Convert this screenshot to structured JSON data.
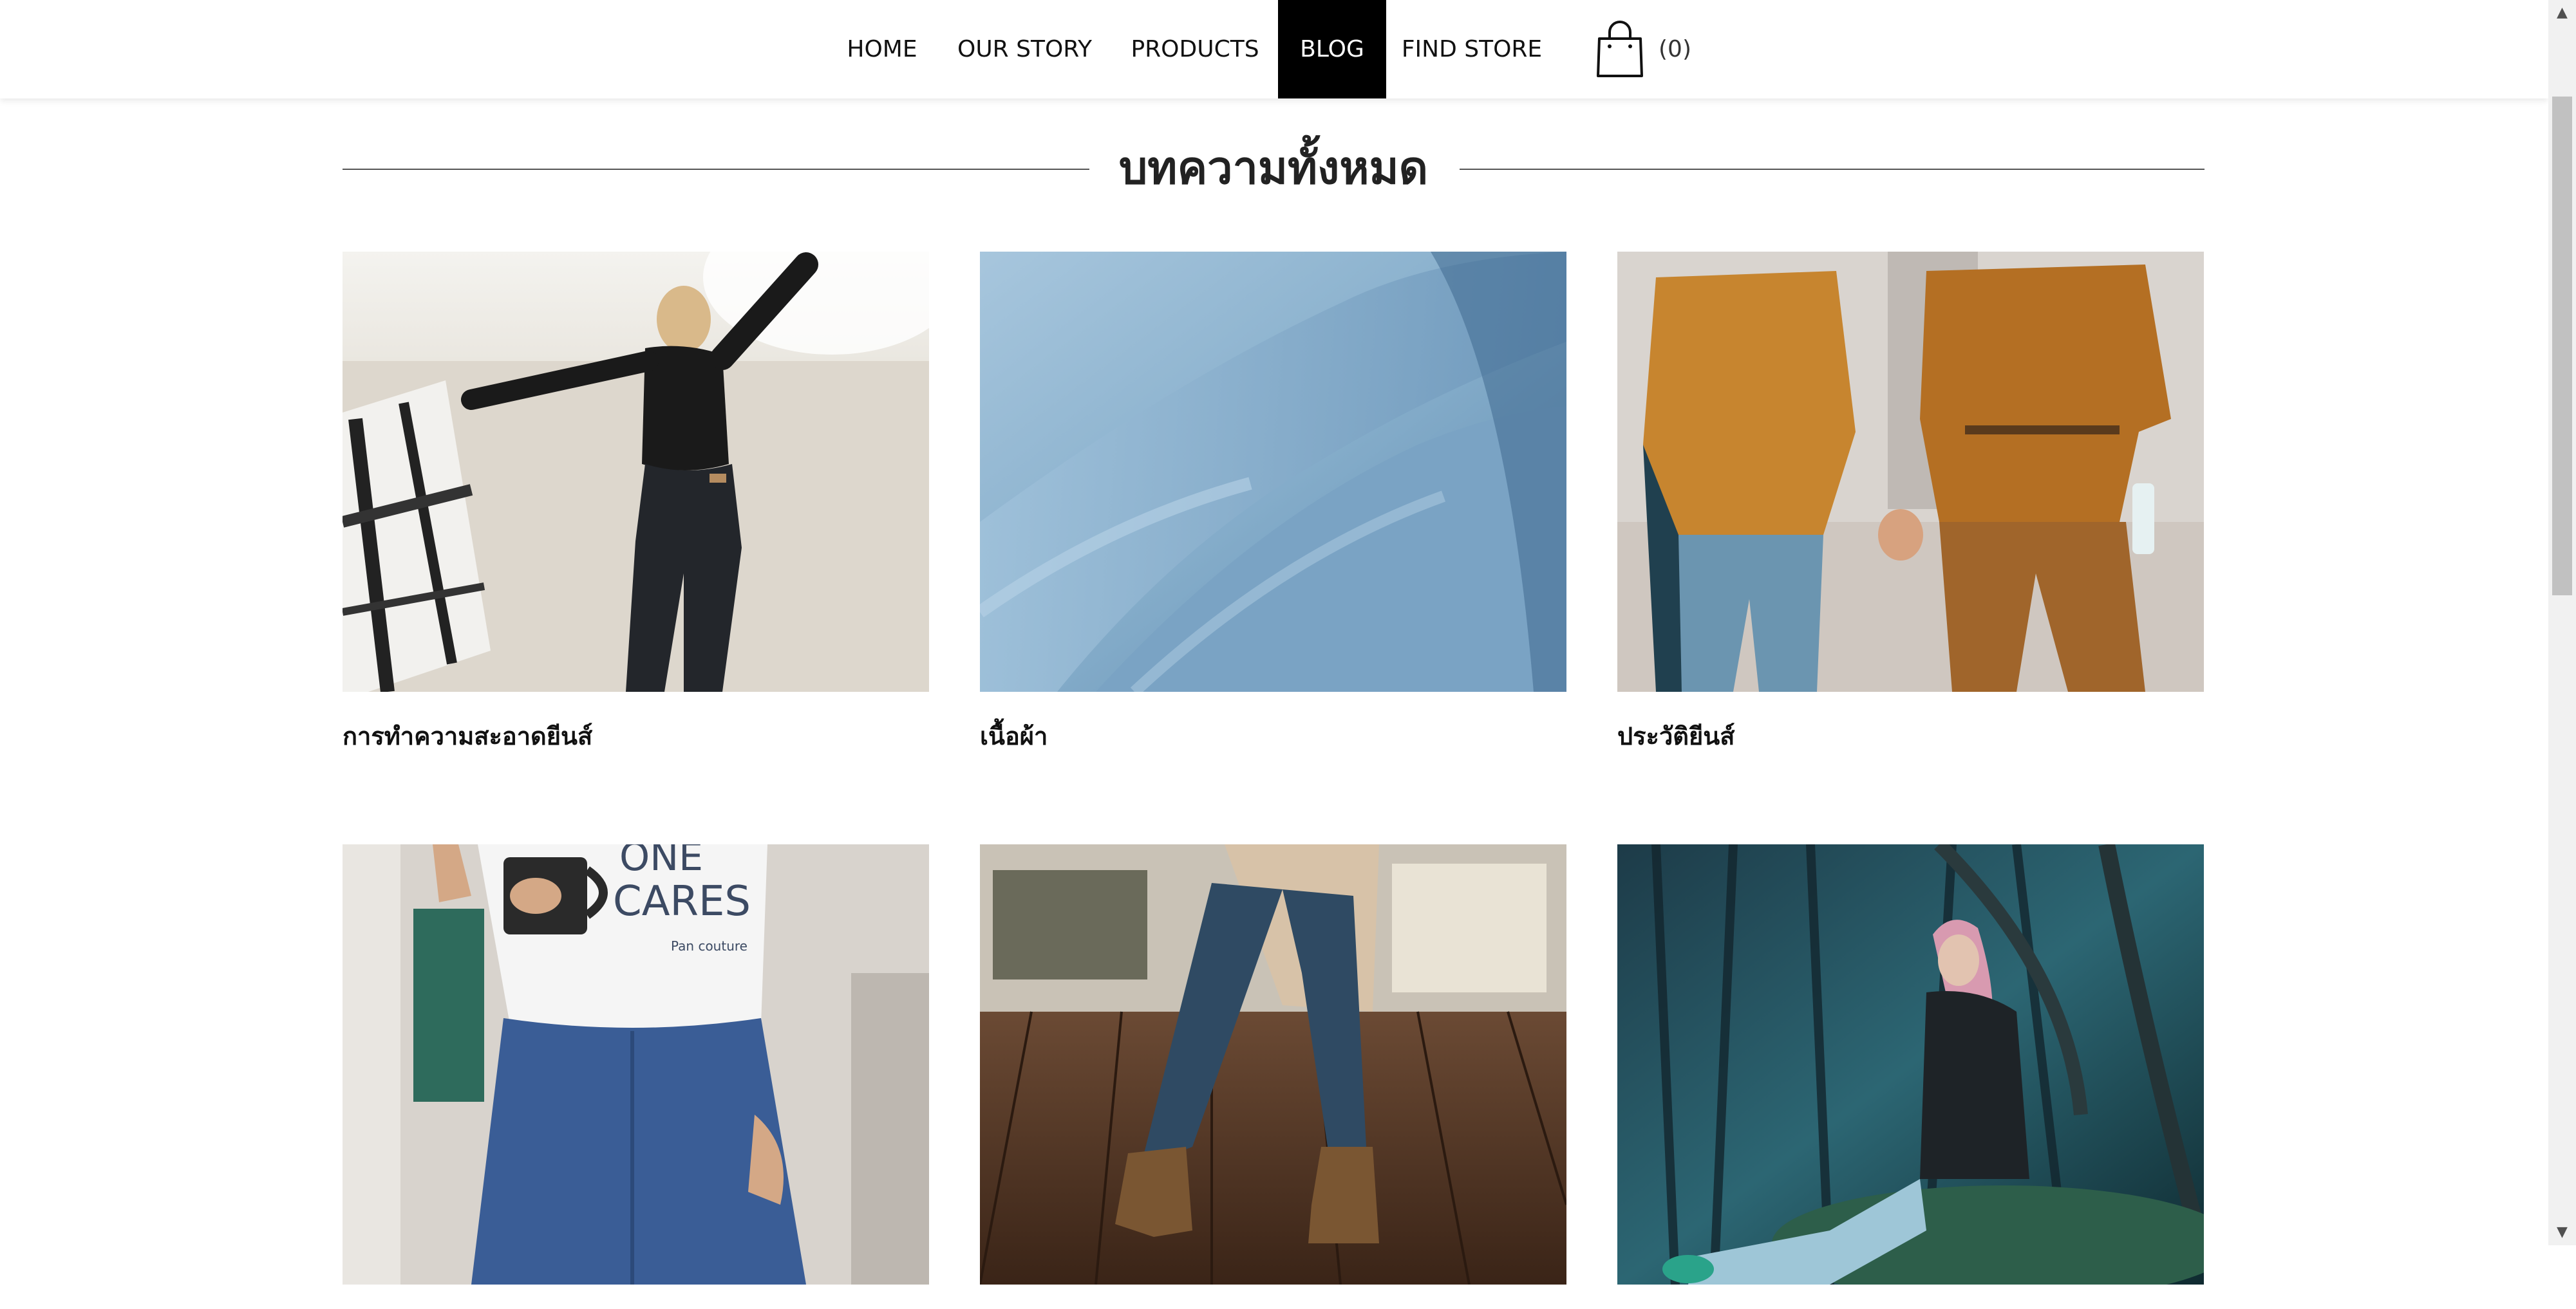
{
  "nav": {
    "items": [
      {
        "label": "HOME"
      },
      {
        "label": "OUR STORY"
      },
      {
        "label": "PRODUCTS"
      },
      {
        "label": "BLOG"
      },
      {
        "label": "FIND STORE"
      }
    ],
    "active_label": "BLOG",
    "cart_count": "(0)",
    "cart_icon": "shopping-bag-icon"
  },
  "page": {
    "title": "บทความทั้งหมด"
  },
  "articles": [
    {
      "title": "การทำความสะอาดยีนส์",
      "image": "woman-on-beach-with-blanket"
    },
    {
      "title": "เนื้อผ้า",
      "image": "denim-fabric-closeup"
    },
    {
      "title": "ประวัติยีนส์",
      "image": "couple-holding-hands-walking"
    },
    {
      "title": "",
      "image": "person-with-mug-and-tshirt"
    },
    {
      "title": "",
      "image": "legs-walking-wood-floor"
    },
    {
      "title": "",
      "image": "woman-sitting-in-forest"
    }
  ],
  "photo_text": {
    "tshirt_print": "CARES",
    "tshirt_print_top": "ONE",
    "tshirt_print_small": "Pan couture"
  },
  "colors": {
    "active_nav_bg": "#000000",
    "active_nav_fg": "#ffffff",
    "text": "#111111",
    "rule": "#555555"
  }
}
